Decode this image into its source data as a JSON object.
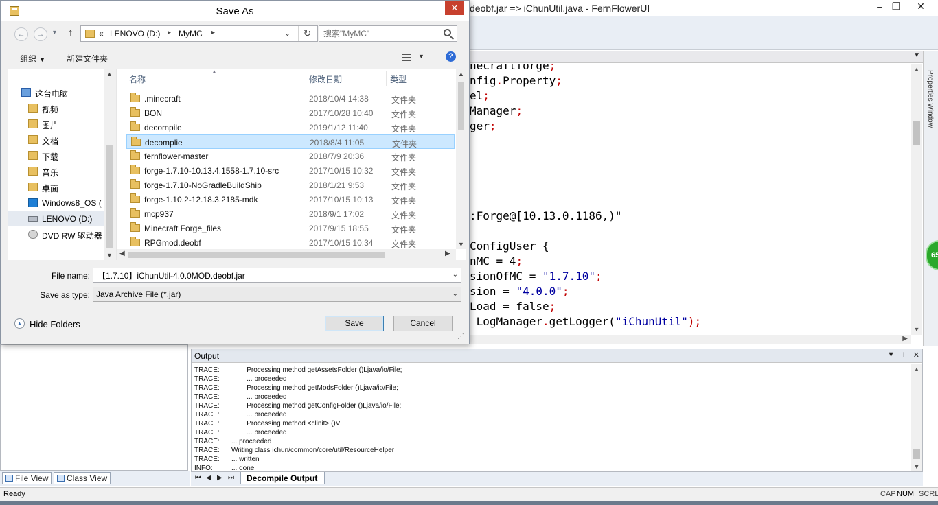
{
  "background_app": {
    "window_title": "deobf.jar => iChunUtil.java - FernFlowerUI",
    "code_lines": [
      {
        "text": "necraftforge",
        "suffix": ";"
      },
      {
        "text": "nfig",
        "dot": ".",
        "text2": "Property",
        "suffix": ";"
      },
      {
        "text": "el",
        "suffix": ";"
      },
      {
        "text": "Manager",
        "suffix": ";"
      },
      {
        "text": "ger",
        "suffix": ";"
      }
    ],
    "code_forge_line": ":Forge@[10.13.0.1186,)\"",
    "code_class_line": "ConfigUser {",
    "code_fields": [
      {
        "left": "nMC = 4",
        "end": ";"
      },
      {
        "left": "sionOfMC = ",
        "str": "\"1.7.10\"",
        "end": ";"
      },
      {
        "left": "sion = ",
        "str": "\"4.0.0\"",
        "end": ";"
      },
      {
        "left": "Load = false",
        "end": ";"
      },
      {
        "left": " LogManager",
        "dot": ".",
        "mid": "getLogger(",
        "str": "\"iChunUtil\"",
        "end": ");"
      }
    ],
    "properties_window_label": "Properties Window",
    "badge_text": "65",
    "left_tabs": {
      "file_view": "File View",
      "class_view": "Class View"
    },
    "output": {
      "title": "Output",
      "tab_label": "Decompile Output",
      "lines": [
        {
          "level": "TRACE:",
          "text": "        Processing method getAssetsFolder ()Ljava/io/File;"
        },
        {
          "level": "TRACE:",
          "text": "        ... proceeded"
        },
        {
          "level": "TRACE:",
          "text": "        Processing method getModsFolder ()Ljava/io/File;"
        },
        {
          "level": "TRACE:",
          "text": "        ... proceeded"
        },
        {
          "level": "TRACE:",
          "text": "        Processing method getConfigFolder ()Ljava/io/File;"
        },
        {
          "level": "TRACE:",
          "text": "        ... proceeded"
        },
        {
          "level": "TRACE:",
          "text": "        Processing method <clinit> ()V"
        },
        {
          "level": "TRACE:",
          "text": "        ... proceeded"
        },
        {
          "level": "TRACE:",
          "text": "... proceeded"
        },
        {
          "level": "TRACE:",
          "text": "Writing class ichun/common/core/util/ResourceHelper"
        },
        {
          "level": "TRACE:",
          "text": "... written"
        },
        {
          "level": "INFO:",
          "text": "... done"
        }
      ]
    },
    "status": {
      "text": "Ready",
      "cap": "CAP",
      "num": "NUM",
      "scrl": "SCRL"
    }
  },
  "dialog": {
    "title": "Save As",
    "close_glyph": "✕",
    "address": {
      "overflow": "«",
      "drive": "LENOVO (D:)",
      "folder": "MyMC"
    },
    "search_placeholder": "搜索\"MyMC\"",
    "commands": {
      "organize": "组织",
      "new_folder": "新建文件夹"
    },
    "nav_items": [
      {
        "label": "这台电脑",
        "icon": "computer-icon"
      },
      {
        "label": "视频",
        "icon": "folder-icon"
      },
      {
        "label": "图片",
        "icon": "folder-icon"
      },
      {
        "label": "文档",
        "icon": "folder-icon"
      },
      {
        "label": "下载",
        "icon": "download-icon"
      },
      {
        "label": "音乐",
        "icon": "folder-icon"
      },
      {
        "label": "桌面",
        "icon": "folder-icon"
      },
      {
        "label": "Windows8_OS (",
        "icon": "drive-icon"
      },
      {
        "label": "LENOVO (D:)",
        "icon": "drive-icon",
        "selected": true
      },
      {
        "label": "DVD RW 驱动器",
        "icon": "dvd-icon"
      }
    ],
    "columns": {
      "name": "名称",
      "date": "修改日期",
      "type": "类型"
    },
    "files": [
      {
        "name": ".minecraft",
        "date": "2018/10/4 14:38",
        "type": "文件夹"
      },
      {
        "name": "BON",
        "date": "2017/10/28 10:40",
        "type": "文件夹"
      },
      {
        "name": "decompile",
        "date": "2019/1/12 11:40",
        "type": "文件夹"
      },
      {
        "name": "decomplie",
        "date": "2018/8/4 11:05",
        "type": "文件夹",
        "selected": true
      },
      {
        "name": "fernflower-master",
        "date": "2018/7/9 20:36",
        "type": "文件夹"
      },
      {
        "name": "forge-1.7.10-10.13.4.1558-1.7.10-src",
        "date": "2017/10/15 10:32",
        "type": "文件夹"
      },
      {
        "name": "forge-1.7.10-NoGradleBuildShip",
        "date": "2018/1/21 9:53",
        "type": "文件夹"
      },
      {
        "name": "forge-1.10.2-12.18.3.2185-mdk",
        "date": "2017/10/15 10:13",
        "type": "文件夹"
      },
      {
        "name": "mcp937",
        "date": "2018/9/1 17:02",
        "type": "文件夹"
      },
      {
        "name": "Minecraft Forge_files",
        "date": "2017/9/15 18:55",
        "type": "文件夹"
      },
      {
        "name": "RPGmod.deobf",
        "date": "2017/10/15 10:34",
        "type": "文件夹"
      }
    ],
    "file_name_label": "File name:",
    "file_name_value": "【1.7.10】iChunUtil-4.0.0MOD.deobf.jar",
    "save_type_label": "Save as type:",
    "save_type_value": "Java Archive File (*.jar)",
    "hide_folders": "Hide Folders",
    "save_button": "Save",
    "cancel_button": "Cancel"
  }
}
